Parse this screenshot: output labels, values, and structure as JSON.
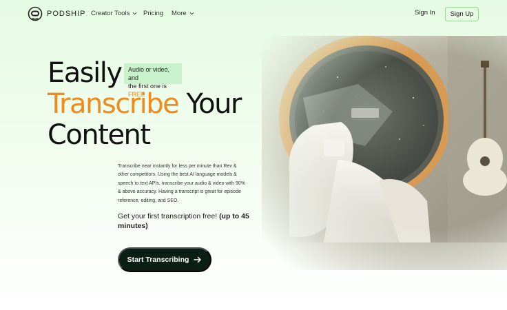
{
  "brand": {
    "name": "PODSHIP"
  },
  "nav": {
    "creator_tools": "Creator Tools",
    "pricing": "Pricing",
    "more": "More",
    "sign_in": "Sign In",
    "sign_up": "Sign Up"
  },
  "hero": {
    "line1": "Easily",
    "line2_accent": "Transcribe",
    "line2_rest": " Your",
    "line3": "Content",
    "badge_line1": "Audio or video, and",
    "badge_line2_prefix": "the first one is ",
    "badge_free": "FREE",
    "description": "Transcribe near instantly for less per minute than Rev & other competitors. Using the best AI language models & speech to text APIs, transcribe your audio & video with 90% & above accuracy. Having a transcript is great for episode reference, editing, and SEO.",
    "subline_normal": "Get your first transcription free! ",
    "subline_bold": "(up to 45 minutes)",
    "cta_label": "Start Transcribing"
  },
  "colors": {
    "accent": "#ee8a1e",
    "cta_bg": "#0c1f16",
    "badge_bg": "#c9f2cc",
    "page_bg": "#e6fbe3"
  },
  "icons": {
    "logo": "astronaut-helmet-icon",
    "chevron": "chevron-down-icon",
    "arrow": "arrow-right-icon"
  }
}
